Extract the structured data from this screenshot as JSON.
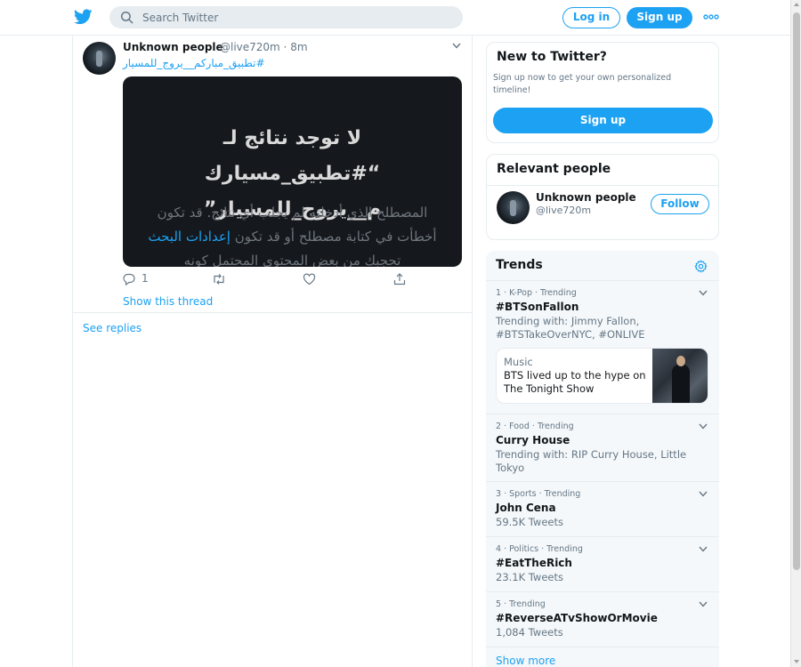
{
  "header": {
    "search_placeholder": "Search Twitter",
    "login_label": "Log in",
    "signup_label": "Sign up"
  },
  "tweet": {
    "author_name": "Unknown people",
    "meta": "@live720m · 8m",
    "text": "#تطبيق_مباركم__يروج_للمسيار",
    "media": {
      "title": "لا توجد نتائج لـ “#تطبيق_مسيارك م__يروج_للمسيار”",
      "body_prefix": "المصطلح الذي أدخلته لم يجلب أي نتائج. قد تكون أخطأت في كتابة مصطلح أو قد تكون ",
      "body_link": "إعدادات البحث",
      "body_suffix": " تحجبك من بعض المحتوى المحتمل كونه"
    },
    "reply_count": "1",
    "show_thread": "Show this thread"
  },
  "see_replies": "See replies",
  "new_to_twitter": {
    "title": "New to Twitter?",
    "subtitle": "Sign up now to get your own personalized timeline!",
    "button": "Sign up"
  },
  "relevant_people": {
    "title": "Relevant people",
    "name": "Unknown people",
    "handle": "@live720m",
    "follow": "Follow"
  },
  "trends": {
    "title": "Trends",
    "items": [
      {
        "meta": "1 · K-Pop · Trending",
        "name": "#BTSonFallon",
        "sub": "Trending with: Jimmy Fallon, #BTSTakeOverNYC, #ONLIVE"
      },
      {
        "meta": "2 · Food · Trending",
        "name": "Curry House",
        "sub": "Trending with: RIP Curry House, Little Tokyo"
      },
      {
        "meta": "3 · Sports · Trending",
        "name": "John Cena",
        "sub": "59.5K Tweets"
      },
      {
        "meta": "4 · Politics · Trending",
        "name": "#EatTheRich",
        "sub": "23.1K Tweets"
      },
      {
        "meta": "5 · Trending",
        "name": "#ReverseATvShowOrMovie",
        "sub": "1,084 Tweets"
      }
    ],
    "news": {
      "category": "Music",
      "headline": "BTS lived up to the hype on The Tonight Show"
    },
    "show_more": "Show more"
  },
  "colors": {
    "accent": "#1da1f2",
    "text": "#14171a",
    "muted": "#657786",
    "border": "#e6ecf0",
    "panel": "#f5f8fa"
  },
  "icons": [
    "twitter-bird-icon",
    "search-icon",
    "more-icon",
    "chevron-down-icon",
    "reply-icon",
    "retweet-icon",
    "like-icon",
    "share-icon",
    "gear-icon"
  ]
}
